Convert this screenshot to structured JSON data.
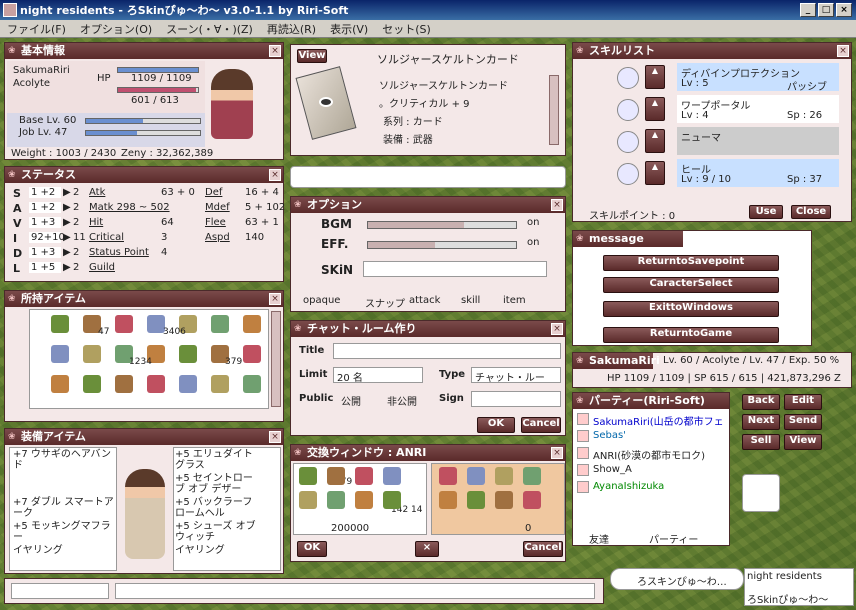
{
  "app": {
    "title": "night residents - ろSkinぴゅ〜わ〜 v3.0-1.1 by Riri-Soft"
  },
  "menu": [
    "ファイル(F)",
    "オプション(O)",
    "スーン(・∀・)(Z)",
    "再読込(R)",
    "表示(V)",
    "セット(S)"
  ],
  "basic": {
    "title": "基本情報",
    "name": "SakumaRiri",
    "job": "Acolyte",
    "hp_label": "HP",
    "hp": "1109 / 1109",
    "sp": "601 / 613",
    "base_lv": "Base Lv. 60",
    "job_lv": "Job Lv. 47",
    "weight": "Weight : 1003 / 2430",
    "zeny": "Zeny : 32,362,389",
    "hp_fraction": 1.0,
    "sp_fraction": 0.98
  },
  "status": {
    "title": "ステータス",
    "letters": [
      "S",
      "A",
      "V",
      "I",
      "D",
      "L"
    ],
    "rows": [
      [
        "1 +2",
        "2"
      ],
      [
        "1 +2",
        "2"
      ],
      [
        "1 +3",
        "2"
      ],
      [
        "92+10",
        "11"
      ],
      [
        "1 +3",
        "2"
      ],
      [
        "1 +5",
        "2"
      ]
    ],
    "left": [
      "Atk",
      "Matk 298 ~ 502",
      "Hit",
      "Critical",
      "Status Point",
      "Guild"
    ],
    "left_vals": [
      "63 + 0",
      "",
      "64",
      "3",
      "4",
      ""
    ],
    "right": [
      "Def",
      "Mdef",
      "Flee",
      "Aspd",
      "",
      ""
    ],
    "right_vals": [
      "16 + 4",
      "5 + 102",
      "63 + 1",
      "140",
      "",
      ""
    ]
  },
  "items": {
    "title": "所持アイテム",
    "counts": [
      "47",
      "3406",
      "1234",
      "379"
    ]
  },
  "equip": {
    "title": "装備アイテム",
    "left": [
      "+7 ウサギのヘアバンド",
      "",
      "+7 ダブル スマートアーク",
      "+5 モッキングマフラー",
      "イヤリング"
    ],
    "right": [
      "+5 エリュダイトグラス",
      "+5 セイントローブ オブ デザー",
      "+5 バックラーフロームヘル",
      "+5 シューズ オブ ウィッチ",
      "イヤリング"
    ]
  },
  "card": {
    "view": "View",
    "title": "ソルジャースケルトンカード",
    "name": "ソルジャースケルトンカード",
    "effect": "。クリティカル + 9",
    "type": "系列 : カード",
    "equip": "装備 : 武器"
  },
  "option": {
    "title": "オプション",
    "bgm": "BGM",
    "eff": "EFF.",
    "skin": "SKiN",
    "on": "on",
    "opaque": "opaque",
    "snap": "スナップ",
    "attack": "attack",
    "skill": "skill",
    "item": "item",
    "bgm_level": 0.65,
    "eff_level": 0.45
  },
  "chat": {
    "title": "チャット・ルーム作り",
    "title_label": "Title",
    "limit_label": "Limit",
    "limit": "20 名",
    "type_label": "Type",
    "type": "チャット・ルーム",
    "public_label": "Public",
    "public_opt": "公開",
    "private_opt": "非公開",
    "sign_label": "Sign",
    "ok": "OK",
    "cancel": "Cancel"
  },
  "trade": {
    "title": "交換ウィンドウ : ANRI",
    "zeny_left": "200000",
    "zeny_right": "0",
    "counts": [
      "2",
      "379",
      "142",
      "14"
    ],
    "ok": "OK",
    "cancel": "Cancel"
  },
  "skills": {
    "title": "スキルリスト",
    "list": [
      {
        "name": "ディバインプロテクション",
        "lv": "Lv : 5",
        "type": "パッシブ"
      },
      {
        "name": "ワープポータル",
        "lv": "Lv : 4",
        "sp": "Sp : 26"
      },
      {
        "name": "ニューマ",
        "lv": "",
        "sp": ""
      },
      {
        "name": "ヒール",
        "lv": "Lv : 9 / 10",
        "sp": "Sp : 37"
      }
    ],
    "points": "スキルポイント : 0",
    "use": "Use",
    "close": "Close"
  },
  "message": {
    "title": "message",
    "buttons": [
      "ReturntoSavepoint",
      "CaracterSelect",
      "ExittoWindows",
      "ReturntoGame"
    ]
  },
  "char_info": {
    "name": "SakumaRiri",
    "levels": "Lv. 60 / Acolyte / Lv. 47 / Exp. 50 %",
    "stats": "HP 1109 / 1109 | SP 615 / 615 | 421,873,296 Z"
  },
  "party": {
    "title": "パーティー(Riri-Soft)",
    "members": [
      "SakumaRiri(山岳の都市フェ",
      "Sebas'",
      "ANRI(砂漠の都市モロク)",
      "Show_A",
      "AyanaIshizuka"
    ],
    "friends": "友達",
    "party": "パーティー",
    "buttons": [
      "Back",
      "Edit",
      "Next",
      "Send",
      "Sell",
      "View"
    ]
  },
  "bottom": {
    "bubble": "ろスキンぴゅ〜わ…",
    "server": "night residents",
    "skin": "ろSkinぴゅ〜わ〜"
  }
}
